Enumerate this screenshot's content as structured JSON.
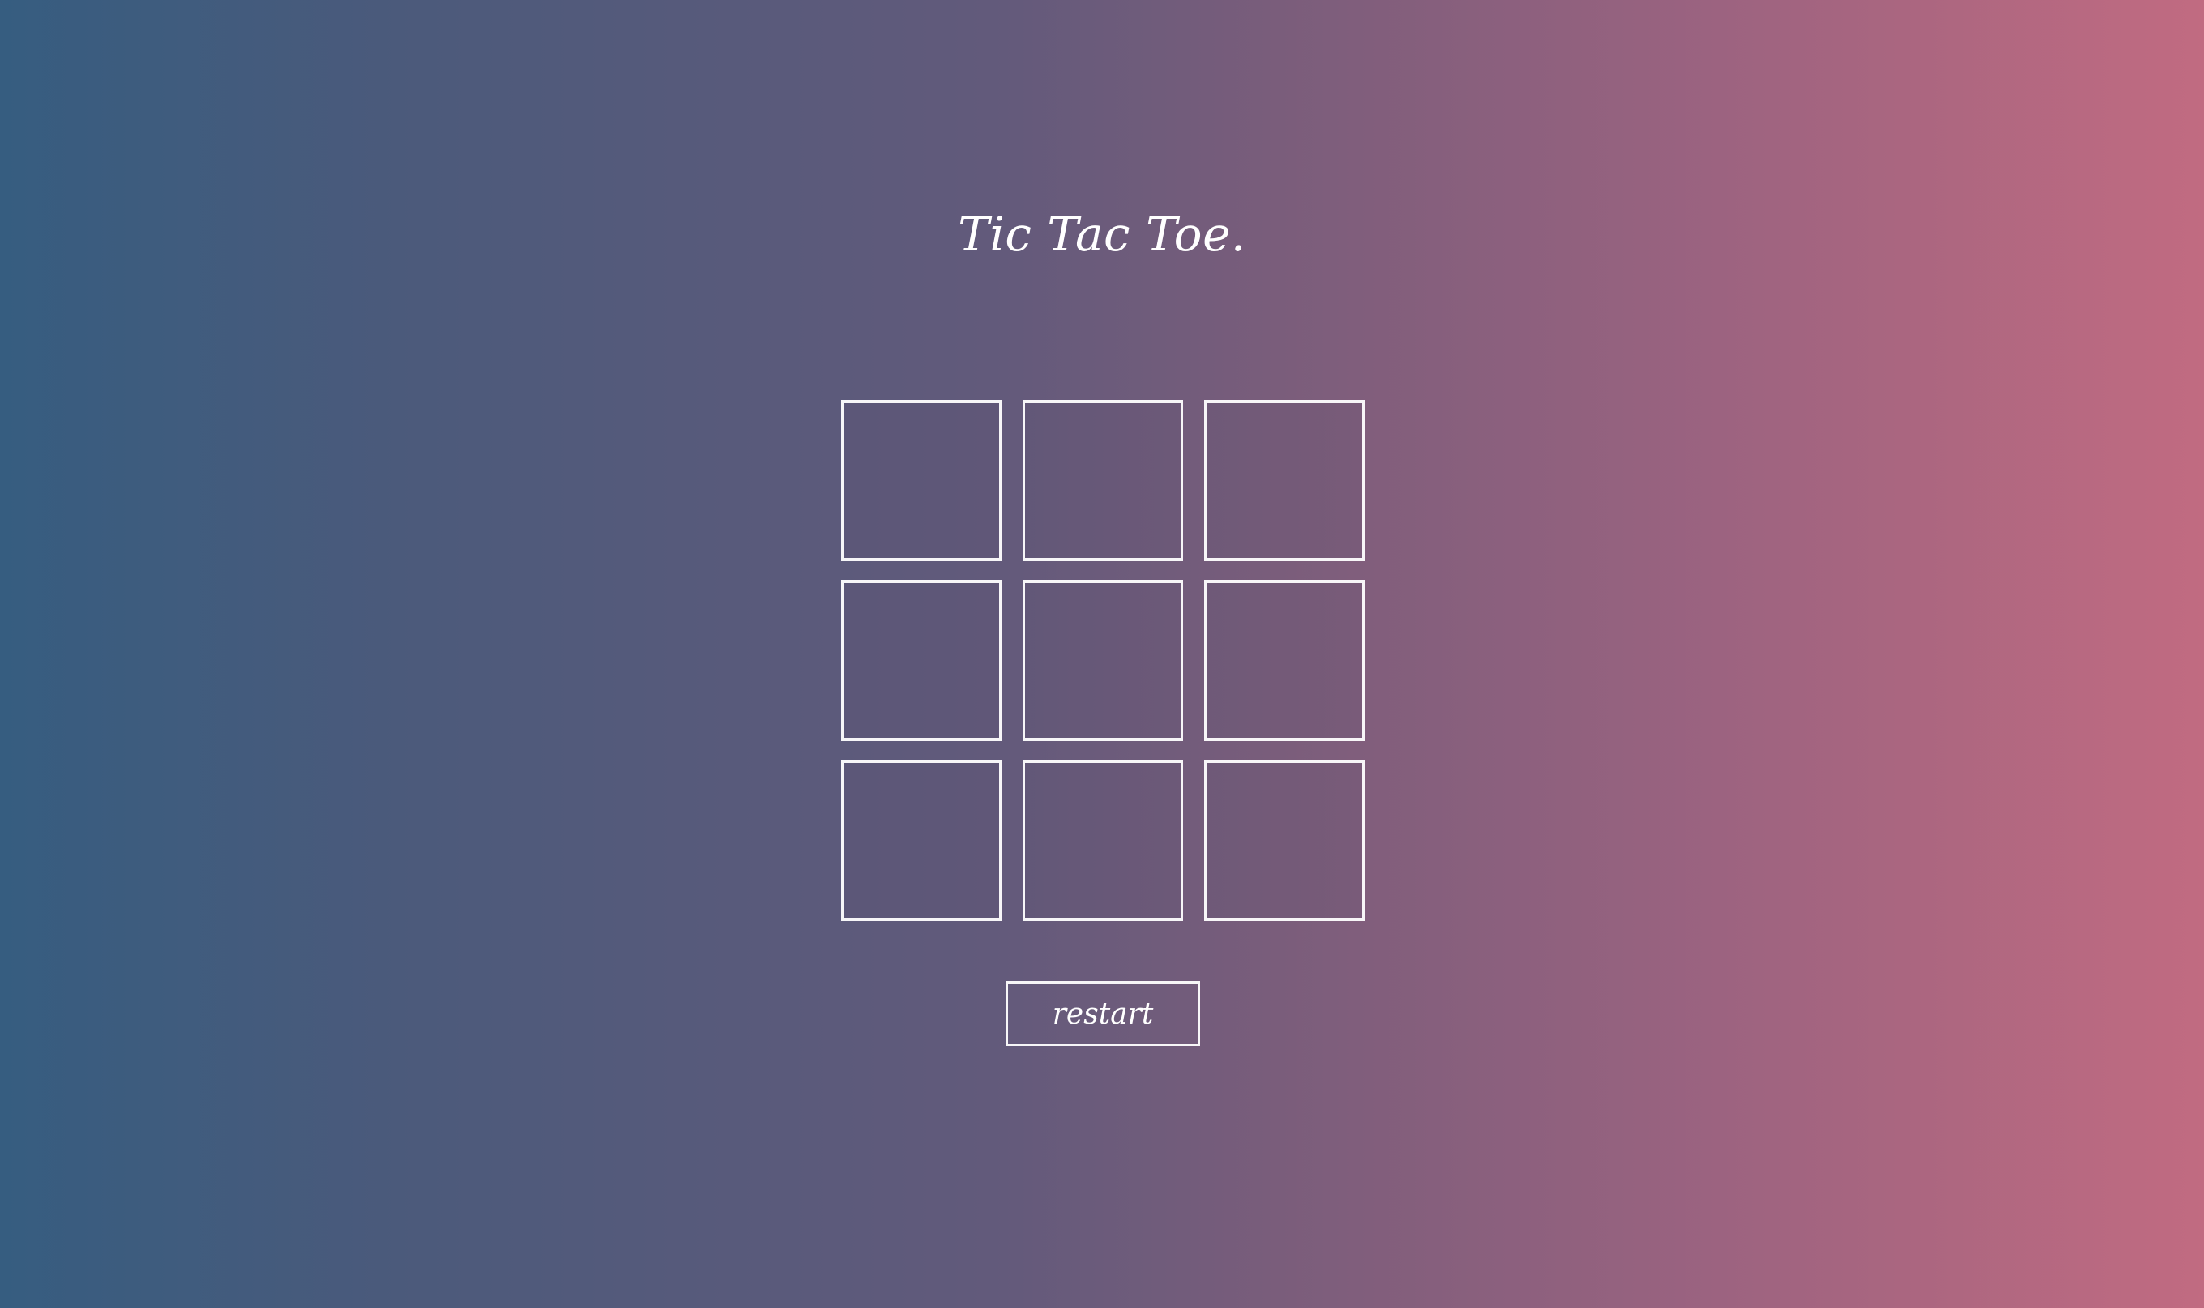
{
  "title": "Tic Tac Toe.",
  "board": {
    "cells": [
      "",
      "",
      "",
      "",
      "",
      "",
      "",
      "",
      ""
    ]
  },
  "controls": {
    "restart_label": "restart"
  },
  "colors": {
    "gradient_left": "#365d80",
    "gradient_right": "#c16b81",
    "foreground": "#ffffff"
  }
}
